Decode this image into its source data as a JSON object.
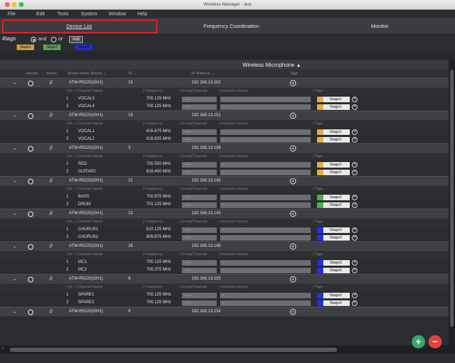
{
  "window": {
    "title": "Wireless Manager - test"
  },
  "menu": [
    "File",
    "Edit",
    "Tools",
    "System",
    "Window",
    "Help"
  ],
  "tabs": [
    {
      "label": "Device List",
      "active": true
    },
    {
      "label": "Frequency Coordination",
      "active": false
    },
    {
      "label": "Monitor",
      "active": false
    }
  ],
  "tagfilter": {
    "label": "#tags",
    "and_label": "and",
    "or_label": "or",
    "add_label": "Add",
    "chips": [
      {
        "label": "Stage1",
        "color": "#c8a33a"
      },
      {
        "label": "Stage2",
        "color": "#5aa15a"
      },
      {
        "label": "Stage3",
        "color": "#1a2fd0"
      }
    ]
  },
  "section": {
    "title": "Wireless Microphone",
    "caret": "^"
  },
  "columns": {
    "identify": "Identify",
    "status": "Status",
    "model": "Model Name (Band) ⌄",
    "id": "ID ⌄",
    "ip": "IP Address ⌄",
    "tags": "Tags"
  },
  "subcolumns": {
    "rx": "| Rx",
    "channel": "| Channel Name",
    "frequency": "| Frequency",
    "group": "| Group/Channel",
    "inclusion": "| Inclusion Group",
    "tags": "| Tags"
  },
  "placeholders": {
    "group": "--   /   --",
    "inclusion": "--"
  },
  "devices": [
    {
      "model": "ATW-R5220(GH1)",
      "id": "15",
      "ip": "192.168.13.162",
      "channels": [
        {
          "rx": "1",
          "name": "VOCAL3",
          "freq": "700.125 MHz",
          "tag": "Stage1",
          "tag_color": "#e8b03c"
        },
        {
          "rx": "2",
          "name": "VOCAL4",
          "freq": "700.125 MHz",
          "tag": "Stage1",
          "tag_color": "#e8b03c"
        }
      ]
    },
    {
      "model": "ATW-R5220(GH1)",
      "id": "19",
      "ip": "192.168.13.151",
      "channels": [
        {
          "rx": "1",
          "name": "VOCAL1",
          "freq": "816.875 MHz",
          "tag": "Stage1",
          "tag_color": "#e8b03c"
        },
        {
          "rx": "2",
          "name": "VOCAL2",
          "freq": "816.825 MHz",
          "tag": "Stage1",
          "tag_color": "#e8b03c"
        }
      ]
    },
    {
      "model": "ATW-R5220(GH1)",
      "id": "3",
      "ip": "192.168.13.139",
      "channels": [
        {
          "rx": "1",
          "name": "RED",
          "freq": "700.550 MHz",
          "tag": "Stage1",
          "tag_color": "#e8b03c"
        },
        {
          "rx": "2",
          "name": "GUITAR2",
          "freq": "819.450 MHz",
          "tag": "Stage1",
          "tag_color": "#e8b03c"
        }
      ]
    },
    {
      "model": "ATW-R5220(GH1)",
      "id": "21",
      "ip": "192.168.13.145",
      "channels": [
        {
          "rx": "1",
          "name": "BASS",
          "freq": "700.875 MHz",
          "tag": "Stage2",
          "tag_color": "#4fae4f"
        },
        {
          "rx": "2",
          "name": "DRUM",
          "freq": "701.125 MHz",
          "tag": "Stage2",
          "tag_color": "#4fae4f"
        }
      ]
    },
    {
      "model": "ATW-R5220(GH1)",
      "id": "23",
      "ip": "192.168.13.143",
      "channels": [
        {
          "rx": "1",
          "name": "CHURUS1",
          "freq": "810.125 MHz",
          "tag": "Stage3",
          "tag_color": "#1a2ff0"
        },
        {
          "rx": "2",
          "name": "CHURUS2",
          "freq": "809.875 MHz",
          "tag": "Stage3",
          "tag_color": "#1a2ff0"
        }
      ]
    },
    {
      "model": "ATW-R5220(GH1)",
      "id": "26",
      "ip": "192.168.13.146",
      "channels": [
        {
          "rx": "1",
          "name": "MC1",
          "freq": "700.125 MHz",
          "tag": "Stage3",
          "tag_color": "#1a2ff0"
        },
        {
          "rx": "2",
          "name": "MC2",
          "freq": "700.375 MHz",
          "tag": "Stage3",
          "tag_color": "#1a2ff0"
        }
      ]
    },
    {
      "model": "ATW-R5220(GH1)",
      "id": "8",
      "ip": "192.168.13.135",
      "channels": [
        {
          "rx": "1",
          "name": "SPARE1",
          "freq": "700.125 MHz",
          "tag": "Stage3",
          "tag_color": "#1a2ff0"
        },
        {
          "rx": "2",
          "name": "SPARE2",
          "freq": "700.125 MHz",
          "tag": "Stage3",
          "tag_color": "#1a2ff0"
        }
      ]
    },
    {
      "model": "ATW-R5220(GH1)",
      "id": "9",
      "ip": "192.168.13.134",
      "channels": []
    }
  ],
  "icons": {
    "expand": "chevron-down-icon",
    "identify": "circle-icon",
    "status": "link-icon",
    "add": "plus-icon",
    "remove": "minus-icon"
  },
  "colors": {
    "accent_red": "#e0202c",
    "add_green": "#3aa66a",
    "remove_red": "#e0433f"
  }
}
